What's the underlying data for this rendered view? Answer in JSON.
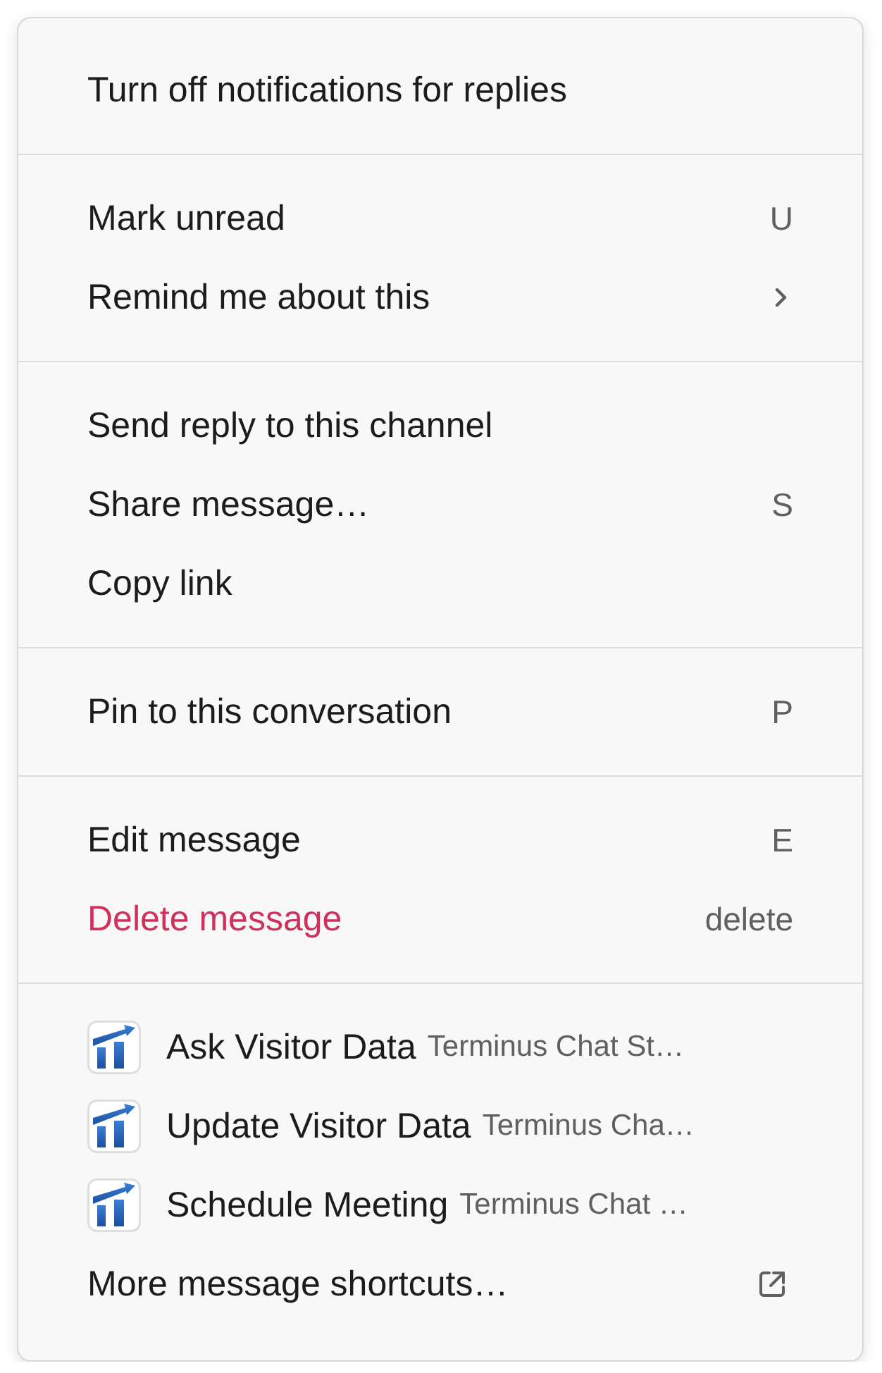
{
  "menu": {
    "sections": [
      {
        "items": [
          {
            "kind": "action",
            "label": "Turn off notifications for replies"
          }
        ]
      },
      {
        "items": [
          {
            "kind": "action",
            "label": "Mark unread",
            "shortcut": "U"
          },
          {
            "kind": "submenu",
            "label": "Remind me about this"
          }
        ]
      },
      {
        "items": [
          {
            "kind": "action",
            "label": "Send reply to this channel"
          },
          {
            "kind": "action",
            "label": "Share message…",
            "shortcut": "S"
          },
          {
            "kind": "action",
            "label": "Copy link"
          }
        ]
      },
      {
        "items": [
          {
            "kind": "action",
            "label": "Pin to this conversation",
            "shortcut": "P"
          }
        ]
      },
      {
        "items": [
          {
            "kind": "action",
            "label": "Edit message",
            "shortcut": "E"
          },
          {
            "kind": "danger",
            "label": "Delete message",
            "shortcut": "delete"
          }
        ]
      },
      {
        "items": [
          {
            "kind": "app",
            "label": "Ask Visitor Data",
            "app": "Terminus Chat St…"
          },
          {
            "kind": "app",
            "label": "Update Visitor Data",
            "app": "Terminus Cha…"
          },
          {
            "kind": "app",
            "label": "Schedule Meeting",
            "app": "Terminus Chat …"
          },
          {
            "kind": "external",
            "label": "More message shortcuts…"
          }
        ]
      }
    ]
  }
}
